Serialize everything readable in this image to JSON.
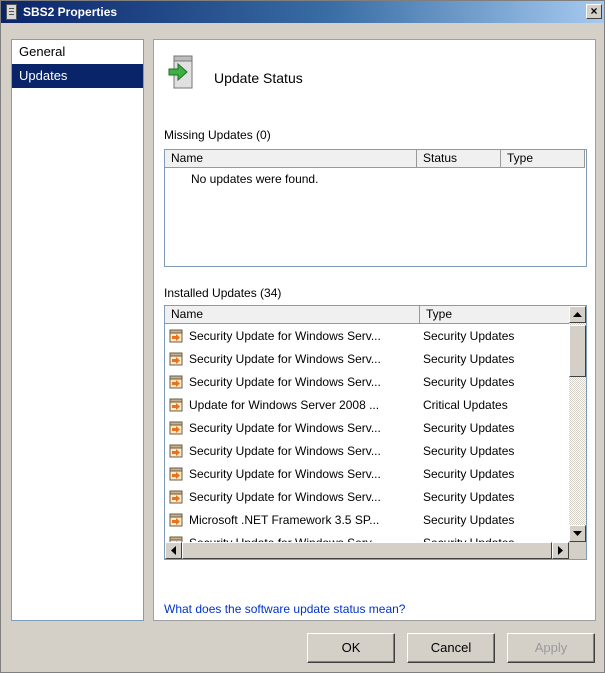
{
  "window": {
    "title": "SBS2 Properties",
    "close_label": "×"
  },
  "nav": {
    "items": [
      {
        "label": "General"
      },
      {
        "label": "Updates"
      }
    ]
  },
  "panel": {
    "title": "Update Status",
    "missing": {
      "label": "Missing Updates (0)",
      "columns": [
        "Name",
        "Status",
        "Type"
      ],
      "empty_message": "No updates were found."
    },
    "installed": {
      "label": "Installed Updates (34)",
      "columns": [
        "Name",
        "Type"
      ],
      "rows": [
        {
          "name": "Security Update for Windows Serv...",
          "type": "Security Updates"
        },
        {
          "name": "Security Update for Windows Serv...",
          "type": "Security Updates"
        },
        {
          "name": "Security Update for Windows Serv...",
          "type": "Security Updates"
        },
        {
          "name": "Update for Windows Server 2008 ...",
          "type": "Critical Updates"
        },
        {
          "name": "Security Update for Windows Serv...",
          "type": "Security Updates"
        },
        {
          "name": "Security Update for Windows Serv...",
          "type": "Security Updates"
        },
        {
          "name": "Security Update for Windows Serv...",
          "type": "Security Updates"
        },
        {
          "name": "Security Update for Windows Serv...",
          "type": "Security Updates"
        },
        {
          "name": "Microsoft .NET Framework 3.5 SP...",
          "type": "Security Updates"
        },
        {
          "name": "Security Update for Windows Serv...",
          "type": "Security Updates"
        }
      ]
    },
    "help_link": "What does the software update status mean?"
  },
  "buttons": {
    "ok": "OK",
    "cancel": "Cancel",
    "apply": "Apply"
  }
}
